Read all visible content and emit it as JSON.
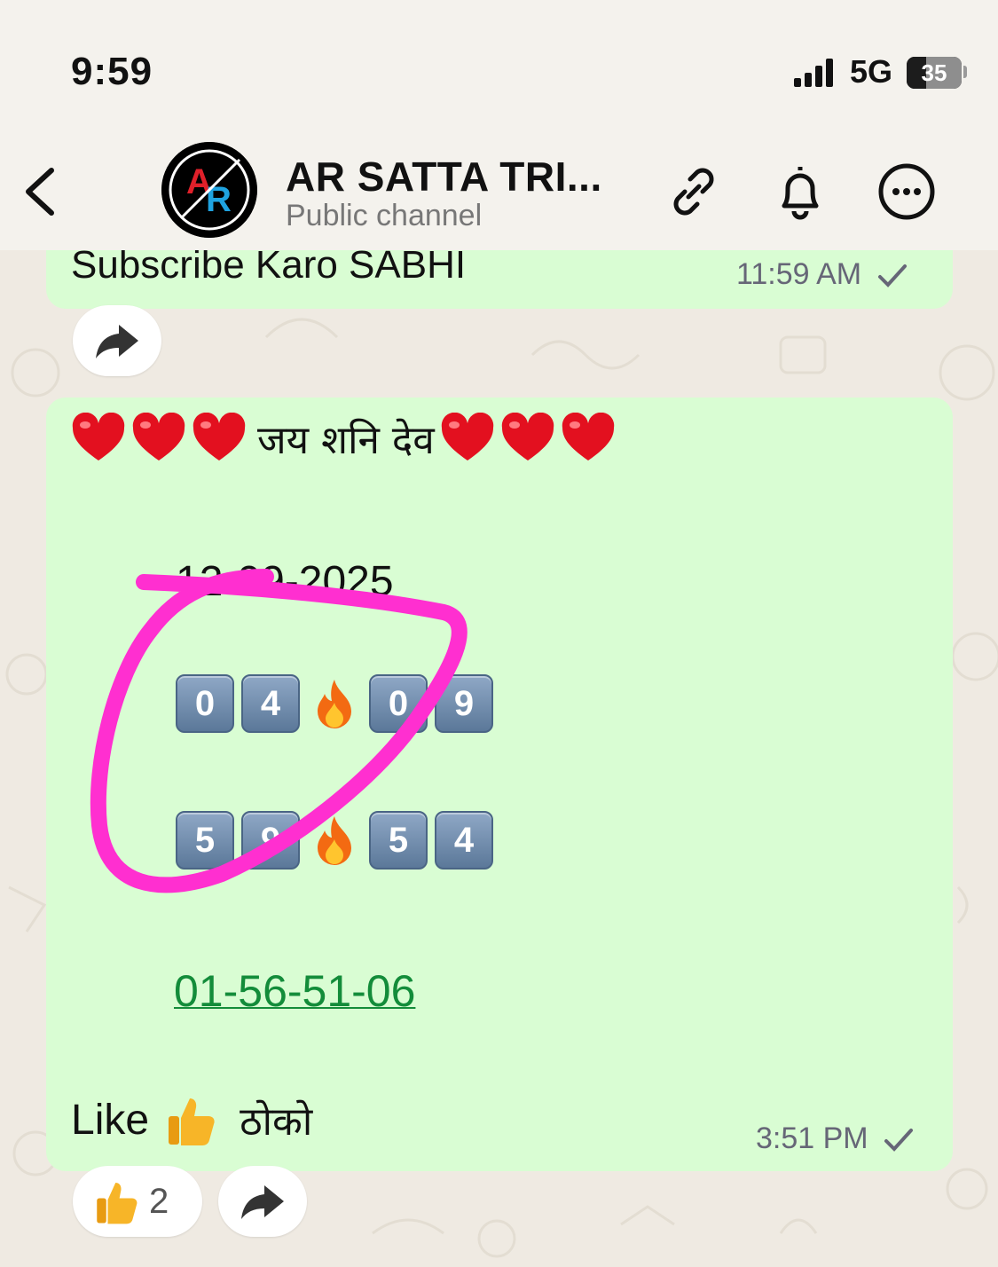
{
  "status_bar": {
    "time": "9:59",
    "network": "5G",
    "battery": "35"
  },
  "header": {
    "title": "AR SATTA TRI...",
    "subtitle": "Public channel"
  },
  "messages": [
    {
      "text": "Subscribe Karo SABHI",
      "time": "11:59 AM"
    },
    {
      "heading": "जय शनि देव",
      "date": "12-09-2025",
      "row1": [
        "0",
        "4",
        "0",
        "9"
      ],
      "row2": [
        "5",
        "9",
        "5",
        "4"
      ],
      "link": "01-56-51-06",
      "like_word": "Like",
      "hindi_word": "ठोको",
      "time": "3:51 PM",
      "reaction_count": "2"
    }
  ],
  "colors": {
    "bubble": "#d9fdd3",
    "link": "#138c3a",
    "annotation": "#ff2fd0"
  },
  "icons": [
    "back-chevron-icon",
    "link-icon",
    "bell-icon",
    "more-icon",
    "forward-icon",
    "heart-icon",
    "fire-icon",
    "thumbs-up-icon"
  ]
}
